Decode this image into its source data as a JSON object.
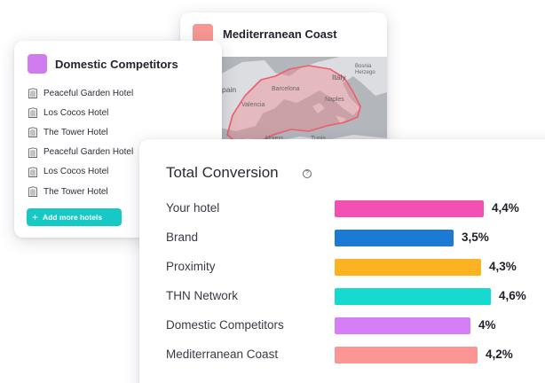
{
  "mediterranean_card": {
    "title": "Mediterranean Coast",
    "swatch_color": "#f79692",
    "map_labels": {
      "spain": "pain",
      "barcelona": "Barcelona",
      "valencia": "Valencia",
      "italy": "Italy",
      "bosnia": "Bosnia",
      "herzego": "Herzego",
      "naples": "Naples",
      "algiers": "Algiers",
      "tunis": "Tunis"
    }
  },
  "domestic_card": {
    "title": "Domestic Competitors",
    "swatch_color": "#d17bf0",
    "hotels": [
      {
        "name": "Peaceful Garden Hotel",
        "icon": "building-icon"
      },
      {
        "name": "Los Cocos Hotel",
        "icon": "building-icon"
      },
      {
        "name": "The Tower Hotel",
        "icon": "building-icon"
      },
      {
        "name": "Peaceful Garden Hotel",
        "icon": "building-icon"
      },
      {
        "name": "Los Cocos Hotel",
        "icon": "building-icon"
      },
      {
        "name": "The Tower Hotel",
        "icon": "building-icon"
      }
    ],
    "add_button": {
      "icon": "plus-icon",
      "label": "Add more hotels",
      "color": "#17c9c5"
    }
  },
  "conversion_card": {
    "title": "Total Conversion",
    "help_icon": "question-circle-icon",
    "help_glyph": "?",
    "rows": [
      {
        "label": "Your hotel",
        "value": 4.4,
        "value_text": "4,4%",
        "color": "#f250b2"
      },
      {
        "label": "Brand",
        "value": 3.5,
        "value_text": "3,5%",
        "color": "#1a7ad4"
      },
      {
        "label": "Proximity",
        "value": 4.3,
        "value_text": "4,3%",
        "color": "#fcb322"
      },
      {
        "label": "THN Network",
        "value": 4.6,
        "value_text": "4,6%",
        "color": "#16d9cf"
      },
      {
        "label": "Domestic Competitors",
        "value": 4.0,
        "value_text": "4%",
        "color": "#d57ef5"
      },
      {
        "label": "Mediterranean Coast",
        "value": 4.2,
        "value_text": "4,2%",
        "color": "#fc9694"
      }
    ]
  }
}
